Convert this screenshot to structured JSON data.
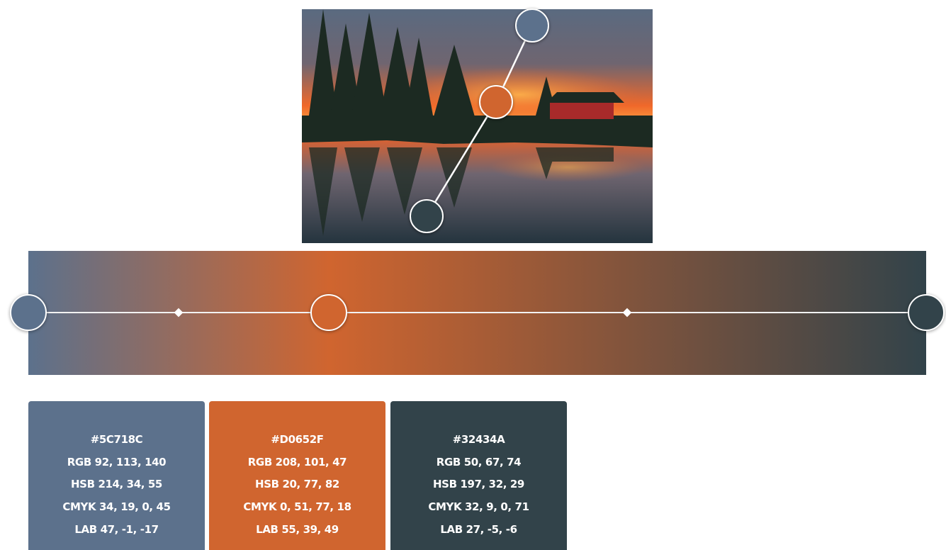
{
  "photo": {
    "colors": {
      "sky_top": "#5a6a80",
      "sky_mid": "#6f6570",
      "sunset": "#f0682a",
      "sun_glow": "#ffb24a",
      "land": "#1c2a22",
      "house": "#a82a2a",
      "water_top": "#e0622e",
      "water_bottom": "#24343e"
    },
    "pickers": [
      {
        "name": "color-picker-1",
        "color": "#5C718C"
      },
      {
        "name": "color-picker-2",
        "color": "#D0652F"
      },
      {
        "name": "color-picker-3",
        "color": "#32434A"
      }
    ]
  },
  "gradient": {
    "stops": [
      {
        "color": "#5C718C",
        "position": 0
      },
      {
        "color": "#D0652F",
        "position": 0.335
      },
      {
        "color": "#32434A",
        "position": 1
      }
    ],
    "midpoints": [
      0.167,
      0.667
    ]
  },
  "swatches": [
    {
      "color": "#5C718C",
      "hex": "#5C718C",
      "rgb": "RGB 92, 113, 140",
      "hsb": "HSB 214, 34, 55",
      "cmyk": "CMYK 34, 19, 0, 45",
      "lab": "LAB 47, -1, -17"
    },
    {
      "color": "#D0652F",
      "hex": "#D0652F",
      "rgb": "RGB 208, 101, 47",
      "hsb": "HSB 20, 77, 82",
      "cmyk": "CMYK 0, 51, 77, 18",
      "lab": "LAB 55, 39, 49"
    },
    {
      "color": "#32434A",
      "hex": "#32434A",
      "rgb": "RGB 50, 67, 74",
      "hsb": "HSB 197, 32, 29",
      "cmyk": "CMYK 32, 9, 0, 71",
      "lab": "LAB 27, -5, -6"
    }
  ]
}
